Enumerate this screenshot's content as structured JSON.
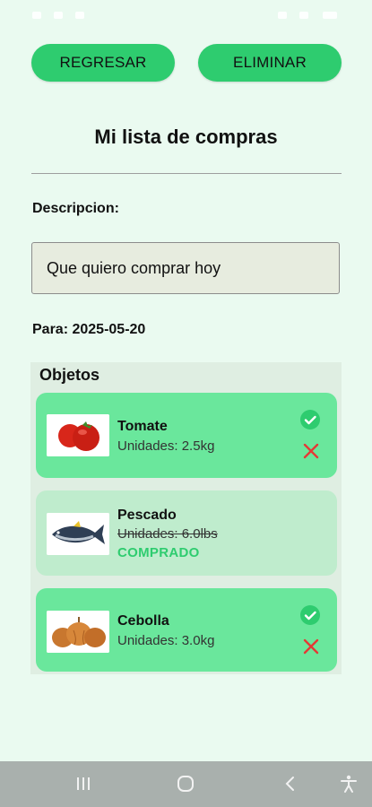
{
  "header": {
    "back_label": "REGRESAR",
    "delete_label": "ELIMINAR"
  },
  "title": "Mi lista de compras",
  "description": {
    "label": "Descripcion:",
    "value": "Que quiero comprar hoy"
  },
  "date_text": "Para: 2025-05-20",
  "objects": {
    "label": "Objetos",
    "items": [
      {
        "name": "Tomate",
        "units": "Unidades: 2.5kg",
        "status": "pending",
        "icon": "tomato-image"
      },
      {
        "name": "Pescado",
        "units": "Unidades: 6.0lbs",
        "status": "bought",
        "status_label": "COMPRADO",
        "icon": "fish-image"
      },
      {
        "name": "Cebolla",
        "units": "Unidades: 3.0kg",
        "status": "pending",
        "icon": "onion-image"
      }
    ]
  },
  "colors": {
    "accent": "#2ecc6f",
    "card_active": "#6ae79c",
    "card_done": "#bfeccd",
    "delete_red": "#e53935",
    "background": "#eafaf0"
  },
  "nav": {
    "icons": [
      "recent-apps-icon",
      "home-icon",
      "back-icon",
      "accessibility-icon"
    ]
  }
}
